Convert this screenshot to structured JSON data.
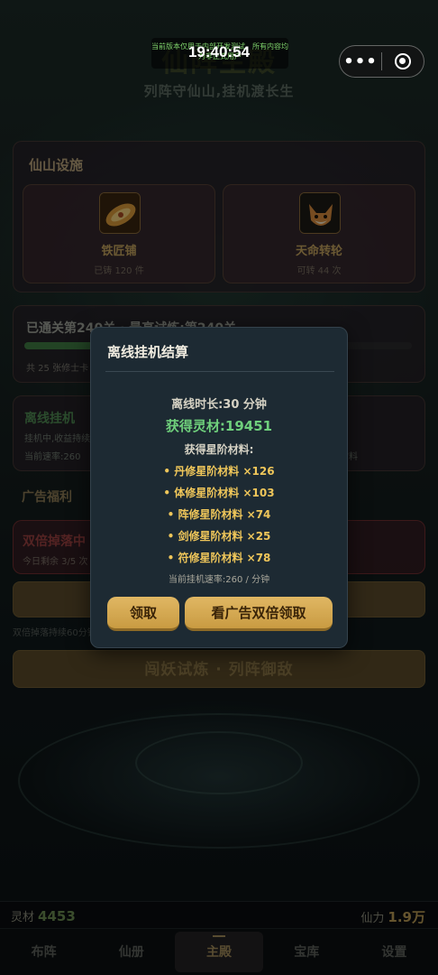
{
  "status": {
    "time": "19:40:54",
    "notice": "当前版本仅用于内部开发测试，所有内容均为非正式用户"
  },
  "header": {
    "title": "仙阵主殿",
    "subtitle": "列阵守仙山,挂机渡长生"
  },
  "facilities": {
    "section_title": "仙山设施",
    "items": [
      {
        "name": "铁匠铺",
        "sub": "已铸 120 件",
        "icon": "forge-icon"
      },
      {
        "name": "天命转轮",
        "sub": "可转 44 次",
        "icon": "fox-wheel-icon"
      }
    ]
  },
  "progress": {
    "title": "已通关第240关 · 最高试炼:第240关",
    "meta": "共 25 张修士卡",
    "fill": 0.33
  },
  "idle": {
    "title": "离线挂机",
    "line1": "挂机中,收益持续累积",
    "line2": "当前速率:260",
    "right": "材料"
  },
  "ads": {
    "section_title": "广告福利",
    "double_title": "双倍掉落中",
    "double_sub": "今日剩余 3/5 次",
    "hint": "双倍掉落持续60分钟",
    "cta": "闯妖试炼 · 列阵御敌"
  },
  "bottom": {
    "currency_label": "灵材",
    "currency_value": "4453",
    "power_label": "仙力",
    "power_value": "1.9万"
  },
  "tabs": [
    {
      "label": "布阵"
    },
    {
      "label": "仙册"
    },
    {
      "label": "主殿"
    },
    {
      "label": "宝库"
    },
    {
      "label": "设置"
    }
  ],
  "modal": {
    "title": "离线挂机结算",
    "duration": "离线时长:30 分钟",
    "gain": "获得灵材:19451",
    "materials_title": "获得星阶材料:",
    "materials": [
      "• 丹修星阶材料 ×126",
      "• 体修星阶材料 ×103",
      "• 阵修星阶材料 ×74",
      "• 剑修星阶材料 ×25",
      "• 符修星阶材料 ×78"
    ],
    "rate": "当前挂机速率:260 / 分钟",
    "claim_label": "领取",
    "double_label": "看广告双倍领取"
  }
}
